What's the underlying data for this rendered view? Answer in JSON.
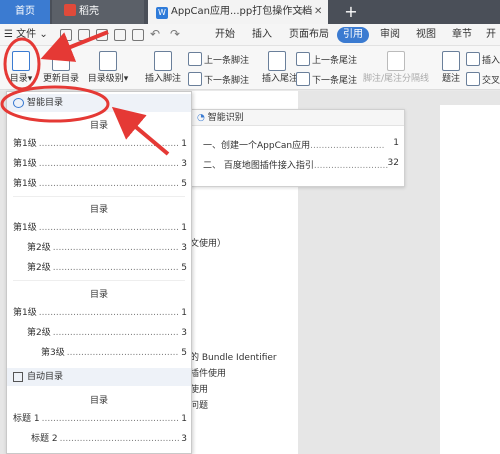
{
  "tabs": {
    "home": "首页",
    "shell": "稻壳",
    "doc": "AppCan应用...pp打包操作文档",
    "new": "+"
  },
  "menubar": {
    "file": "文件",
    "items": [
      "开始",
      "插入",
      "页面布局",
      "引用",
      "审阅",
      "视图",
      "章节",
      "开"
    ],
    "active": "引用"
  },
  "ribbon": {
    "toc": "目录",
    "update_toc": "更新目录",
    "toc_level": "目录级别",
    "insert_footnote": "插入脚注",
    "prev_footnote": "上一条脚注",
    "next_footnote": "下一条脚注",
    "prev_endnote": "上一条尾注",
    "insert_endnote": "插入尾注",
    "next_endnote": "下一条尾注",
    "separator": "脚注/尾注分隔线",
    "caption": "题注",
    "insert": "插入",
    "cross_ref": "交叉"
  },
  "toc_panel": {
    "smart_header": "智能目录",
    "auto_header": "自动目录",
    "title": "目录",
    "group1": [
      {
        "label": "第1级",
        "page": "1"
      },
      {
        "label": "第1级",
        "page": "3"
      },
      {
        "label": "第1级",
        "page": "5"
      }
    ],
    "group2": [
      {
        "label": "第1级",
        "page": "1"
      },
      {
        "label": "第2级",
        "page": "3"
      },
      {
        "label": "第2级",
        "page": "5"
      }
    ],
    "group3": [
      {
        "label": "第1级",
        "page": "1"
      },
      {
        "label": "第2级",
        "page": "3"
      },
      {
        "label": "第3级",
        "page": "5"
      }
    ],
    "auto": [
      {
        "label": "标题 1",
        "page": "1"
      },
      {
        "label": "标题 2",
        "page": "3"
      }
    ]
  },
  "smart_popup": {
    "header": "智能识别",
    "rows": [
      {
        "label": "一、创建一个AppCan应用",
        "page": "1"
      },
      {
        "label": "二、 百度地图插件接入指引",
        "page": "32"
      }
    ]
  },
  "doc_lines": [
    "文使用）",
    "的 Bundle Identifier",
    "插件使用",
    "使用",
    "问题"
  ],
  "accent": "#3b7bd1",
  "annotation_color": "#e53935"
}
